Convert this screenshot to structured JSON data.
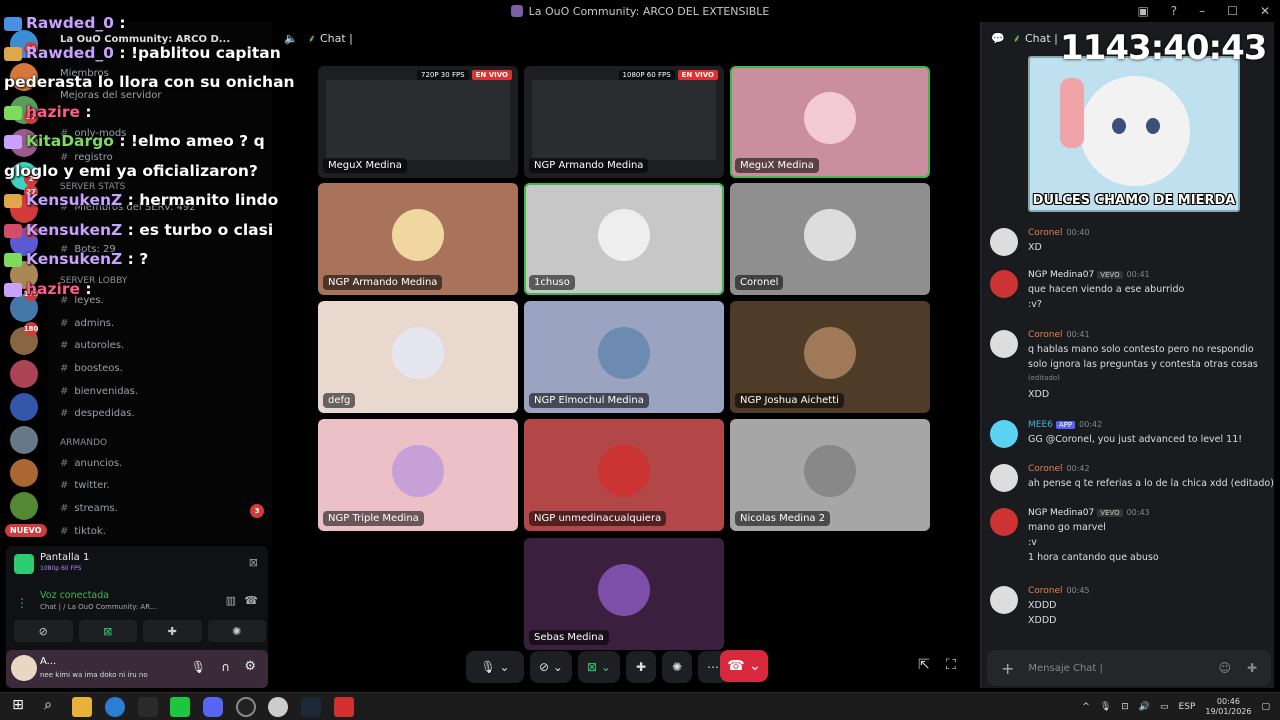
{
  "window": {
    "title": "La OuO Community: ARCO DEL EXTENSIBLE"
  },
  "overlay_chat": [
    {
      "user": "Rawded_0",
      "text": ":",
      "user_color": "#c9a2ff"
    },
    {
      "user": "Rawded_0",
      "text": ": !pablitou capitan",
      "user_color": "#c9a2ff"
    },
    {
      "user": "",
      "text": "pederasta lo llora con su onichan",
      "user_color": "#ffffff"
    },
    {
      "user": "hazire",
      "text": ":",
      "user_color": "#ff5c8a"
    },
    {
      "user": "KitaDargo",
      "text": ": !elmo ameo        ? q",
      "user_color": "#7ddc5d"
    },
    {
      "user": "",
      "text": "gloglo y emi ya oficializaron?",
      "user_color": "#ffffff"
    },
    {
      "user": "KensukenZ",
      "text": ": hermanito lindo",
      "user_color": "#c9a2ff"
    },
    {
      "user": "KensukenZ",
      "text": ": es turbo o clasi",
      "user_color": "#c9a2ff"
    },
    {
      "user": "KensukenZ",
      "text": ": ?",
      "user_color": "#c9a2ff"
    },
    {
      "user": "hazire",
      "text": ":",
      "user_color": "#ff5c8a"
    }
  ],
  "sidebar": {
    "server_name": "La OuO Community: ARCO D...",
    "items": [
      {
        "label": "Miembros",
        "kind": "text"
      },
      {
        "label": "Mejoras del servidor",
        "kind": "text"
      },
      {
        "label": "only-mods",
        "kind": "channel"
      },
      {
        "label": "registro",
        "kind": "channel"
      },
      {
        "label": "SERVER STATS",
        "kind": "category"
      },
      {
        "label": "Miembros del SERV: 492",
        "kind": "channel"
      },
      {
        "label": "Bots: 29",
        "kind": "channel"
      },
      {
        "label": "SERVER LOBBY",
        "kind": "category"
      },
      {
        "label": "leyes.",
        "kind": "channel"
      },
      {
        "label": "admins.",
        "kind": "channel"
      },
      {
        "label": "autoroles.",
        "kind": "channel"
      },
      {
        "label": "boosteos.",
        "kind": "channel"
      },
      {
        "label": "bienvenidas.",
        "kind": "channel"
      },
      {
        "label": "despedidas.",
        "kind": "channel"
      },
      {
        "label": "ARMANDO",
        "kind": "category"
      },
      {
        "label": "anuncios.",
        "kind": "channel"
      },
      {
        "label": "twitter.",
        "kind": "channel"
      },
      {
        "label": "streams.",
        "kind": "channel"
      },
      {
        "label": "tiktok.",
        "kind": "channel"
      }
    ],
    "rail_badges": [
      "62",
      "27",
      "2",
      "27",
      "18",
      "179",
      "180"
    ],
    "nuevo_label": "NUEVO",
    "streams_badge": "3"
  },
  "screenshare": {
    "title": "Pantalla 1",
    "quality": "1080p 60 FPS",
    "voice_status": "Voz conectada",
    "voice_channel": "Chat | / La OuO Community: AR..."
  },
  "user": {
    "name": "A...",
    "status": "nee kimi wa ima doko ni iru no"
  },
  "voice": {
    "channel_name": "Chat |"
  },
  "tiles": [
    {
      "name": "MeguX Medina",
      "live": true,
      "quality": "720P 30 FPS",
      "live_label": "EN VIVO",
      "bg": "#1d1e22"
    },
    {
      "name": "NGP Armando Medina",
      "live": true,
      "quality": "1080P 60 FPS",
      "live_label": "EN VIVO",
      "bg": "#1d1e22"
    },
    {
      "name": "MeguX Medina",
      "live": false,
      "bg": "#c98f9e"
    },
    {
      "name": "NGP Armando Medina",
      "live": false,
      "bg": "#a8735a"
    },
    {
      "name": "1chuso",
      "live": false,
      "bg": "#c7c7c7"
    },
    {
      "name": "Coronel",
      "live": false,
      "bg": "#8f8f8f"
    },
    {
      "name": "defg",
      "live": false,
      "bg": "#e8d8ce"
    },
    {
      "name": "NGP Elmochul Medina",
      "live": false,
      "bg": "#9aa3bf"
    },
    {
      "name": "NGP Joshua Aichetti",
      "live": false,
      "bg": "#4e3c28"
    },
    {
      "name": "NGP Triple Medina",
      "live": false,
      "bg": "#ebc0c6"
    },
    {
      "name": "NGP unmedinacualquiera",
      "live": false,
      "bg": "#b34748"
    },
    {
      "name": "Nicolas Medina 2",
      "live": false,
      "bg": "#a6a6a6"
    },
    {
      "name": "Sebas Medina",
      "live": false,
      "bg": "#3a1f3e"
    }
  ],
  "chat": {
    "header": "Chat |",
    "timer": "1143:40:43",
    "meme_caption": "DULCES CHAMO DE MIERDA",
    "input_placeholder": "Mensaje   Chat |",
    "messages": [
      {
        "user": "Coronel",
        "time": "00:40",
        "user_color": "#e67e52",
        "lines": [
          "XD"
        ]
      },
      {
        "user": "NGP Medina07",
        "time": "00:41",
        "user_color": "#e8e8e8",
        "tag": "VEVO",
        "lines": [
          "que hacen viendo a ese aburrido",
          ":v?"
        ]
      },
      {
        "user": "Coronel",
        "time": "00:41",
        "user_color": "#e67e52",
        "lines": [
          "q hablas mano solo contesto pero no respondio",
          "solo ignora las preguntas y contesta otras cosas",
          "(editado)",
          "XDD"
        ]
      },
      {
        "user": "MEE6",
        "time": "00:42",
        "user_color": "#43b3e0",
        "tag": "APP",
        "lines": [
          "GG @Coronel, you just advanced to level 11!"
        ]
      },
      {
        "user": "Coronel",
        "time": "00:42",
        "user_color": "#e67e52",
        "lines": [
          "ah pense q te referias a lo de la chica xdd (editado)"
        ]
      },
      {
        "user": "NGP Medina07",
        "time": "00:43",
        "user_color": "#e8e8e8",
        "tag": "VEVO",
        "lines": [
          "mano go marvel",
          ":v",
          "1 hora cantando que abuso"
        ]
      },
      {
        "user": "Coronel",
        "time": "00:45",
        "user_color": "#e67e52",
        "lines": [
          "XDDD",
          "XDDD"
        ]
      }
    ]
  },
  "taskbar": {
    "lang": "ESP",
    "time": "00:46",
    "date": "19/01/2026"
  }
}
